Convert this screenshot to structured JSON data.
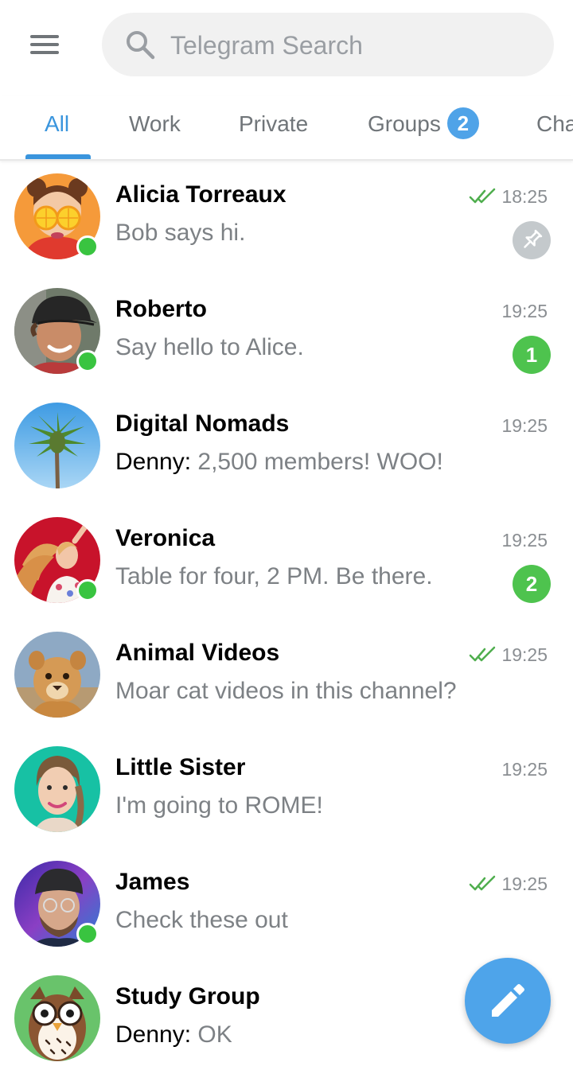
{
  "search": {
    "placeholder": "Telegram Search"
  },
  "icons": {
    "menu": "hamburger-menu-icon",
    "search": "search-icon",
    "read": "double-check-icon",
    "pinned": "pin-icon",
    "compose": "pencil-icon"
  },
  "colors": {
    "accent": "#3a95dd",
    "online": "#39c440",
    "unread_badge": "#4ec34e",
    "fab": "#4ea4ea"
  },
  "tabs": [
    {
      "label": "All",
      "active": true
    },
    {
      "label": "Work"
    },
    {
      "label": "Private"
    },
    {
      "label": "Groups",
      "badge": "2"
    },
    {
      "label": "Channels"
    }
  ],
  "chats": [
    {
      "name": "Alicia Torreaux",
      "time": "18:25",
      "preview": "Bob says hi.",
      "read": true,
      "pinned": true,
      "online": true
    },
    {
      "name": "Roberto",
      "time": "19:25",
      "preview": "Say hello to Alice.",
      "unread": "1",
      "online": true
    },
    {
      "name": "Digital Nomads",
      "time": "19:25",
      "sender": "Denny:",
      "preview": "2,500 members! WOO!"
    },
    {
      "name": "Veronica",
      "time": "19:25",
      "preview": "Table for four, 2 PM. Be there.",
      "unread": "2",
      "online": true
    },
    {
      "name": "Animal Videos",
      "time": "19:25",
      "preview": "Moar cat videos in this channel?",
      "read": true
    },
    {
      "name": "Little Sister",
      "time": "19:25",
      "preview": "I'm going to ROME!"
    },
    {
      "name": "James",
      "time": "19:25",
      "preview": "Check these out",
      "read": true,
      "online": true
    },
    {
      "name": "Study Group",
      "sender": "Denny:",
      "preview": "OK"
    }
  ]
}
